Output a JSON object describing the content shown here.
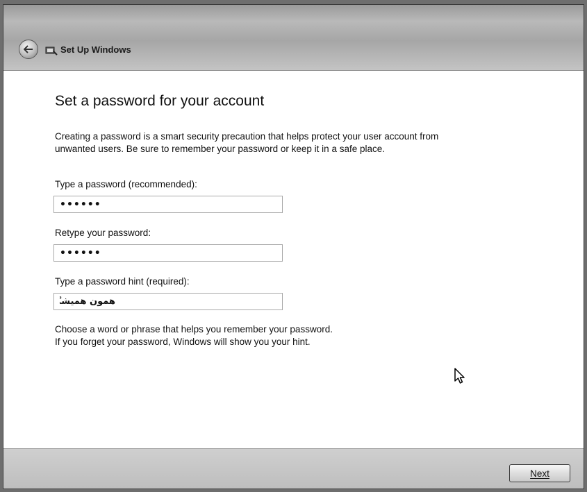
{
  "window": {
    "title": "Set Up Windows",
    "back_icon": "back-arrow-icon",
    "app_icon": "windows-setup-icon"
  },
  "page": {
    "heading": "Set a password for your account",
    "intro_line1": "Creating a password is a smart security precaution that helps protect your user account from",
    "intro_line2": "unwanted users. Be sure to remember your password or keep it in a safe place."
  },
  "fields": {
    "password_label": "Type a password (recommended):",
    "password_value": "••••••",
    "retype_label": "Retype your password:",
    "retype_value": "••••••",
    "hint_label": "Type a password hint (required):",
    "hint_value": "همون همیشگی"
  },
  "footnote": {
    "line1": "Choose a word or phrase that helps you remember your password.",
    "line2": "If you forget your password, Windows will show you your hint."
  },
  "buttons": {
    "next_label": "Next"
  }
}
